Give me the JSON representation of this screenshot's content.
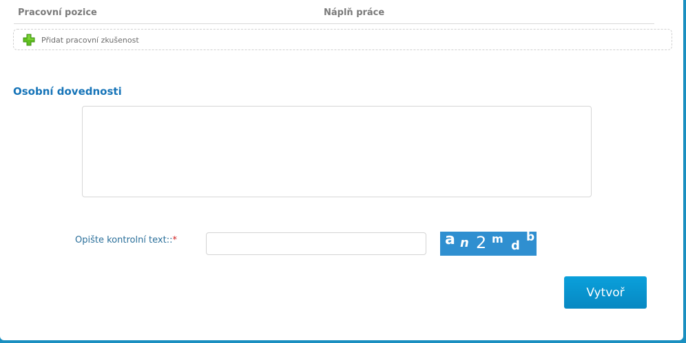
{
  "experience": {
    "columns": [
      "Pracovní pozice",
      "Náplň práce"
    ],
    "add_label": "Přidat pracovní zkušenost"
  },
  "skills": {
    "title": "Osobní dovednosti",
    "value": ""
  },
  "captcha": {
    "label": "Opište kontrolní text::",
    "required_mark": "*",
    "input_value": "",
    "image_chars": [
      "a",
      "n",
      "2",
      "m",
      "d",
      "b"
    ]
  },
  "submit": {
    "label": "Vytvoř"
  },
  "colors": {
    "accent": "#1674b8",
    "button": "#0a97d3",
    "captcha_bg": "#2f8fd0",
    "required": "#d02020",
    "plus_icon": "#5fbf1f"
  },
  "icons": {
    "add": "plus-icon"
  }
}
